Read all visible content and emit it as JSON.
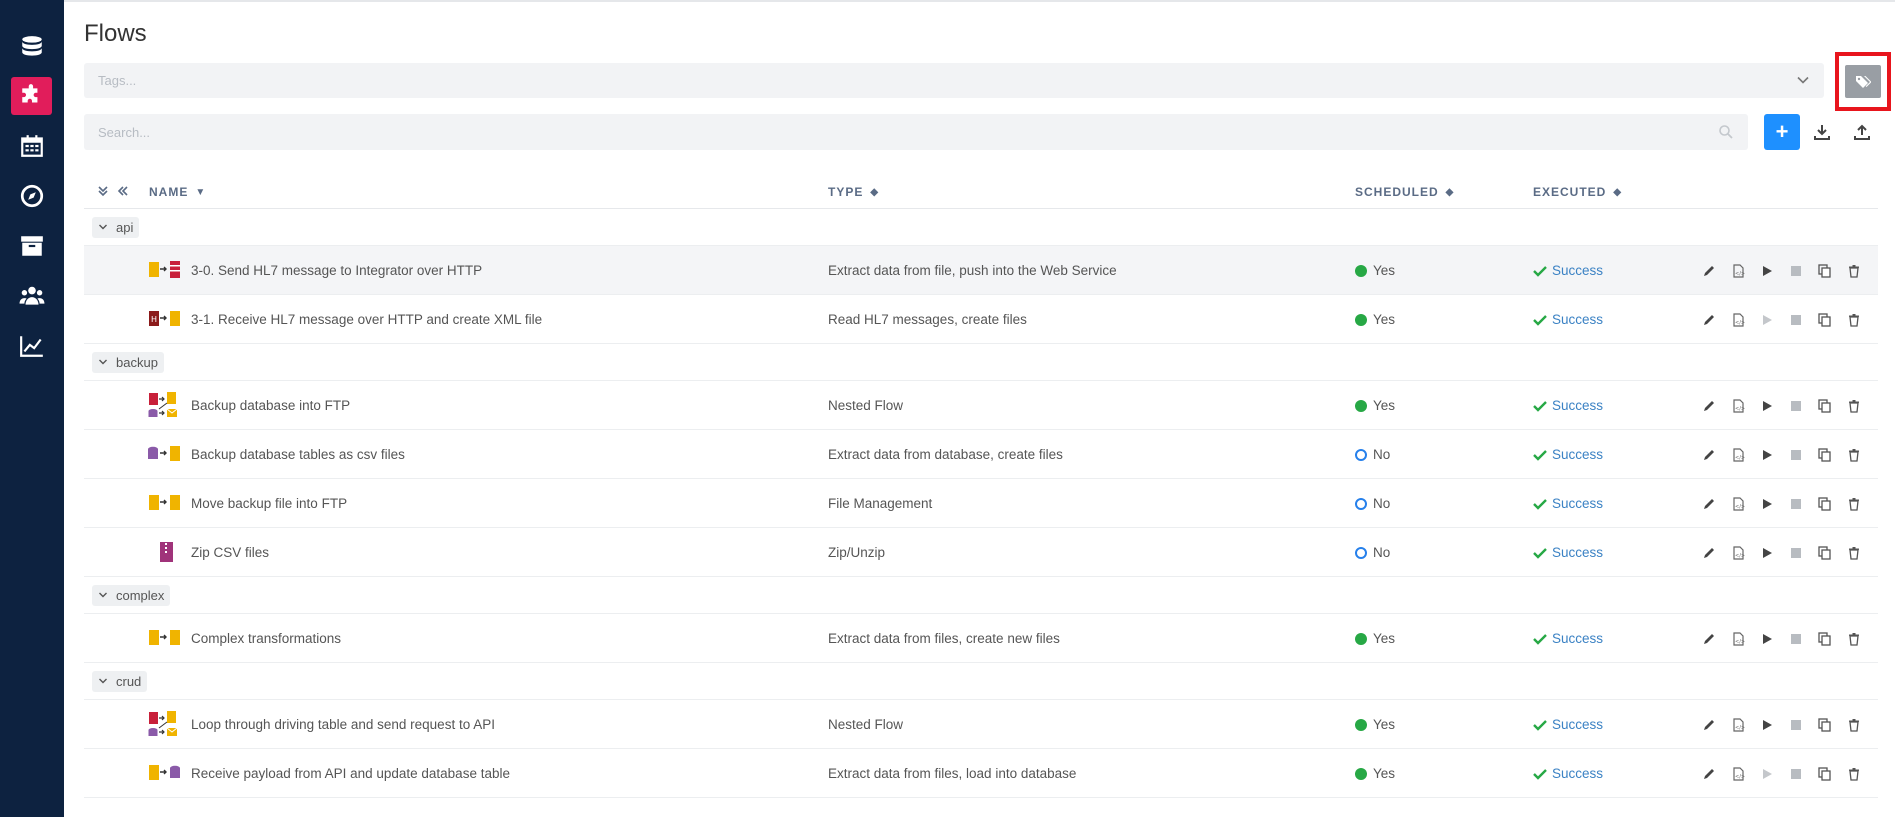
{
  "sidebar": {
    "items": [
      {
        "icon": "database-icon"
      },
      {
        "icon": "puzzle-icon",
        "active": true
      },
      {
        "icon": "calendar-icon"
      },
      {
        "icon": "compass-icon"
      },
      {
        "icon": "archive-icon"
      },
      {
        "icon": "users-icon"
      },
      {
        "icon": "chart-icon"
      }
    ]
  },
  "page": {
    "title": "Flows"
  },
  "tags": {
    "placeholder": "Tags..."
  },
  "search": {
    "placeholder": "Search..."
  },
  "toolbar": {
    "add_label": "+"
  },
  "table": {
    "headers": {
      "name": "NAME",
      "type": "TYPE",
      "scheduled": "SCHEDULED",
      "executed": "EXECUTED"
    },
    "groups": [
      {
        "label": "api",
        "rows": [
          {
            "name": "3-0. Send HL7 message to Integrator over HTTP",
            "type": "Extract data from file, push into the Web Service",
            "scheduled": "Yes",
            "executed": "Success"
          },
          {
            "name": "3-1. Receive HL7 message over HTTP and create XML file",
            "type": "Read HL7 messages, create files",
            "scheduled": "Yes",
            "executed": "Success"
          }
        ]
      },
      {
        "label": "backup",
        "rows": [
          {
            "name": "Backup database into FTP",
            "type": "Nested Flow",
            "scheduled": "Yes",
            "executed": "Success"
          },
          {
            "name": "Backup database tables as csv files",
            "type": "Extract data from database, create files",
            "scheduled": "No",
            "executed": "Success"
          },
          {
            "name": "Move backup file into FTP",
            "type": "File Management",
            "scheduled": "No",
            "executed": "Success"
          },
          {
            "name": "Zip CSV files",
            "type": "Zip/Unzip",
            "scheduled": "No",
            "executed": "Success"
          }
        ]
      },
      {
        "label": "complex",
        "rows": [
          {
            "name": "Complex transformations",
            "type": "Extract data from files, create new files",
            "scheduled": "Yes",
            "executed": "Success"
          }
        ]
      },
      {
        "label": "crud",
        "rows": [
          {
            "name": "Loop through driving table and send request to API",
            "type": "Nested Flow",
            "scheduled": "Yes",
            "executed": "Success"
          },
          {
            "name": "Receive payload from API and update database table",
            "type": "Extract data from files, load into database",
            "scheduled": "Yes",
            "executed": "Success"
          }
        ]
      }
    ]
  },
  "colors": {
    "sidebar_bg": "#0d2240",
    "active_accent": "#e11d5b",
    "primary_button": "#1e90ff",
    "success_green": "#27a845",
    "link_blue": "#3b82c4",
    "highlight_red": "#e8151d"
  }
}
